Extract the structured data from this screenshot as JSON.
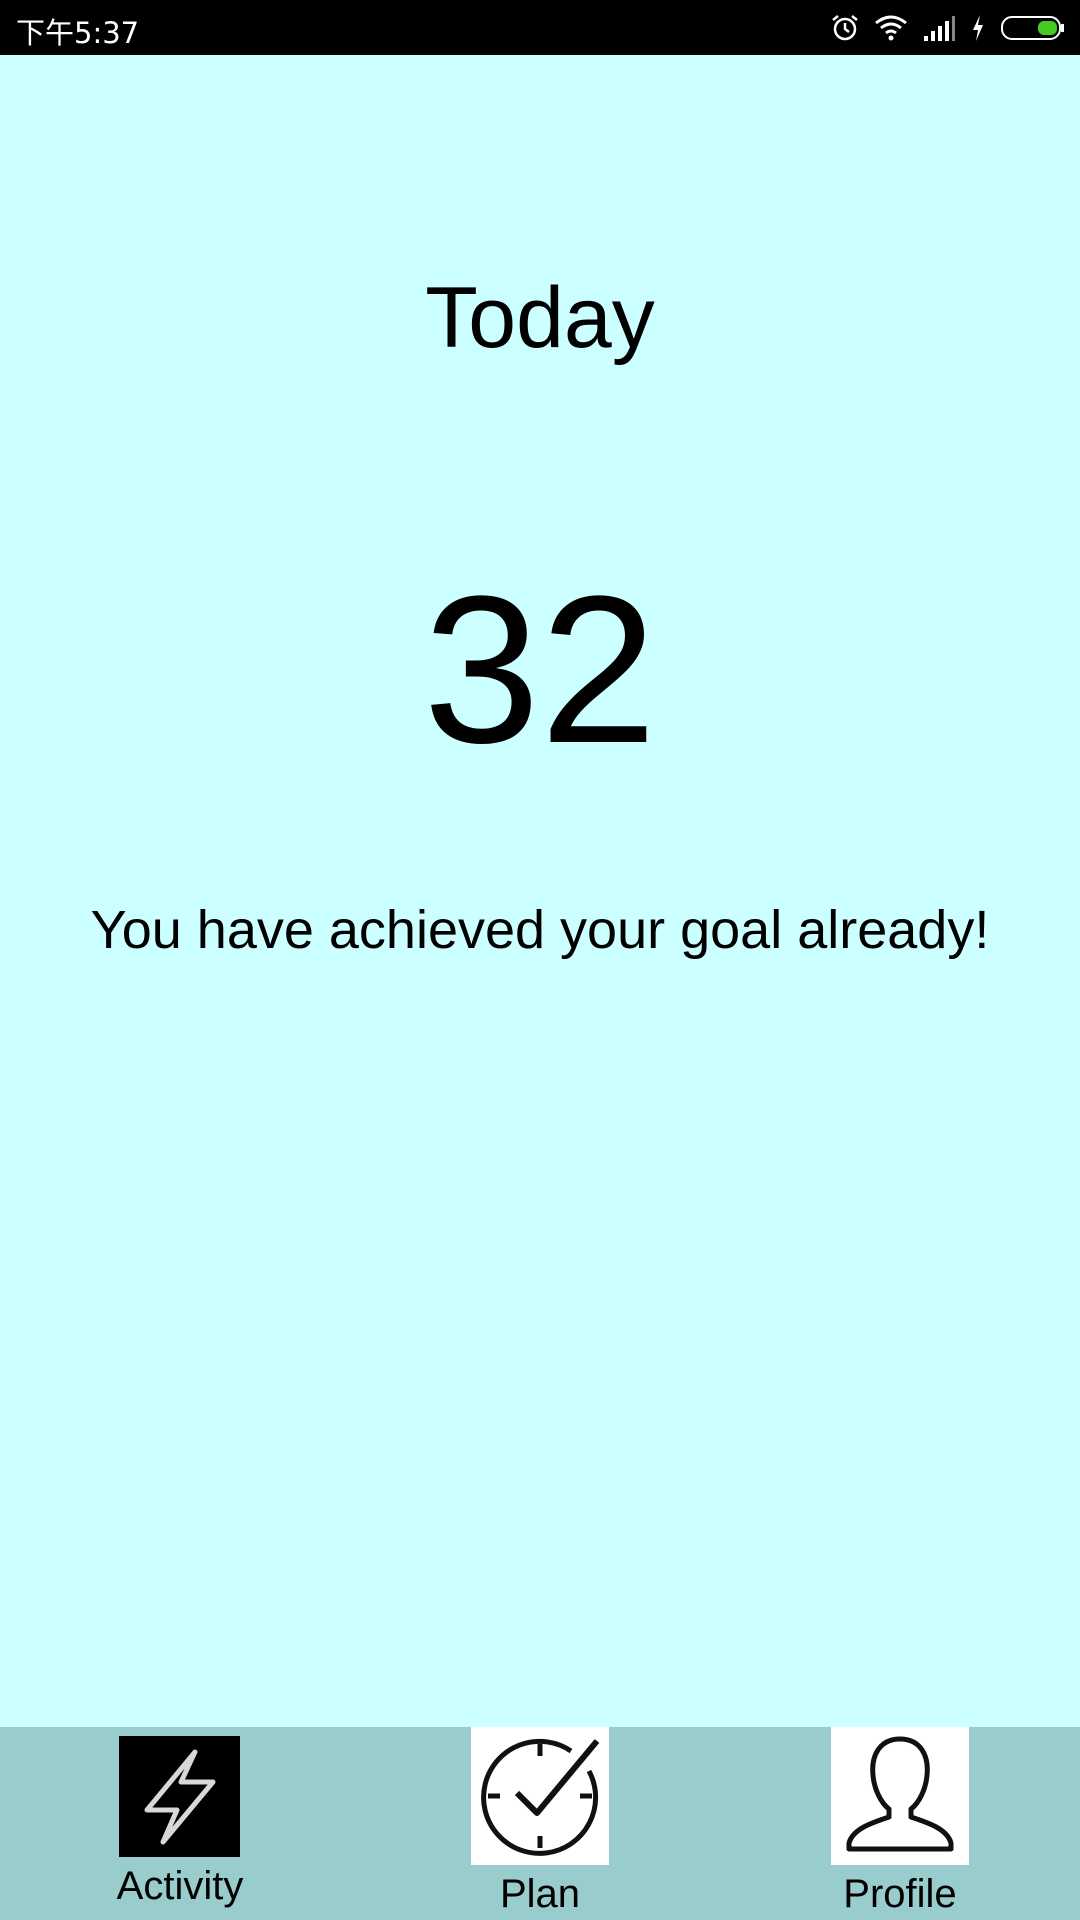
{
  "status_bar": {
    "time": "下午5:37",
    "icons": [
      "alarm-icon",
      "wifi-icon",
      "signal-icon",
      "charging-icon",
      "battery-icon"
    ],
    "battery_color": "#44cc22"
  },
  "main": {
    "title": "Today",
    "count": "32",
    "message": "You have achieved your goal already!"
  },
  "bottom_nav": {
    "items": [
      {
        "label": "Activity",
        "icon": "lightning-icon",
        "active": true
      },
      {
        "label": "Plan",
        "icon": "clock-check-icon",
        "active": false
      },
      {
        "label": "Profile",
        "icon": "person-icon",
        "active": false
      }
    ]
  },
  "colors": {
    "background": "#ccffff",
    "nav_background": "#99cccc",
    "status_bar": "#000000"
  }
}
